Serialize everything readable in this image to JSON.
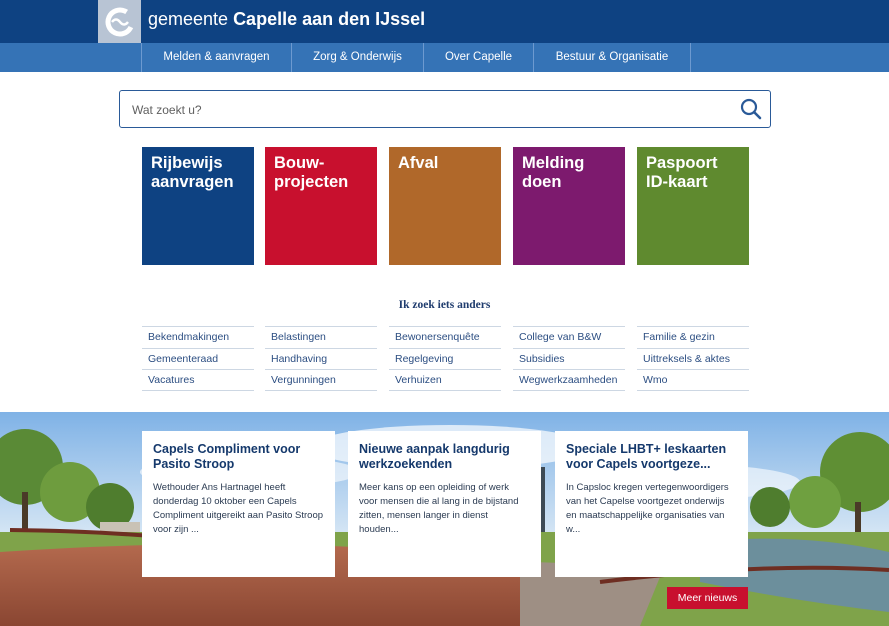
{
  "header": {
    "title_prefix": "gemeente ",
    "title_bold": "Capelle aan den IJssel",
    "logo_icon": "capelle-logo-icon"
  },
  "nav": {
    "items": [
      {
        "label": "Melden & aanvragen"
      },
      {
        "label": "Zorg & Onderwijs"
      },
      {
        "label": "Over Capelle"
      },
      {
        "label": "Bestuur & Organisatie"
      }
    ]
  },
  "search": {
    "placeholder": "Wat zoekt u?",
    "icon": "search-icon"
  },
  "tiles": [
    {
      "line1": "Rijbewijs",
      "line2": "aanvragen",
      "color": "#0e4282"
    },
    {
      "line1": "Bouw-",
      "line2": "projecten",
      "color": "#c8102e"
    },
    {
      "line1": "Afval",
      "line2": "",
      "color": "#b0682a"
    },
    {
      "line1": "Melding",
      "line2": "doen",
      "color": "#7d1a6e"
    },
    {
      "line1": "Paspoort",
      "line2": "ID-kaart",
      "color": "#5f8a2f"
    }
  ],
  "other": {
    "heading": "Ik zoek iets anders",
    "columns": [
      [
        "Bekendmakingen",
        "Gemeenteraad",
        "Vacatures"
      ],
      [
        "Belastingen",
        "Handhaving",
        "Vergunningen"
      ],
      [
        "Bewonersenquête",
        "Regelgeving",
        "Verhuizen"
      ],
      [
        "College van B&W",
        "Subsidies",
        "Wegwerkzaamheden"
      ],
      [
        "Familie & gezin",
        "Uittreksels & aktes",
        "Wmo"
      ]
    ]
  },
  "news": [
    {
      "title": "Capels Compliment voor Pasito Stroop",
      "text": "Wethouder Ans Hartnagel heeft donderdag 10 oktober een Capels Compliment uitgereikt aan Pasito Stroop voor zijn ..."
    },
    {
      "title": "Nieuwe aanpak langdurig werkzoekenden",
      "text": "Meer kans op een opleiding of werk voor mensen die al lang in de bijstand zitten, mensen langer in dienst houden..."
    },
    {
      "title": "Speciale LHBT+ leskaarten voor Capels voortgeze...",
      "text": "In Capsloc kregen vertegenwoordigers van het Capelse voortgezet onderwijs en maatschappelijke organisaties van w..."
    }
  ],
  "more_news": {
    "label": "Meer nieuws",
    "color": "#c8102e"
  }
}
